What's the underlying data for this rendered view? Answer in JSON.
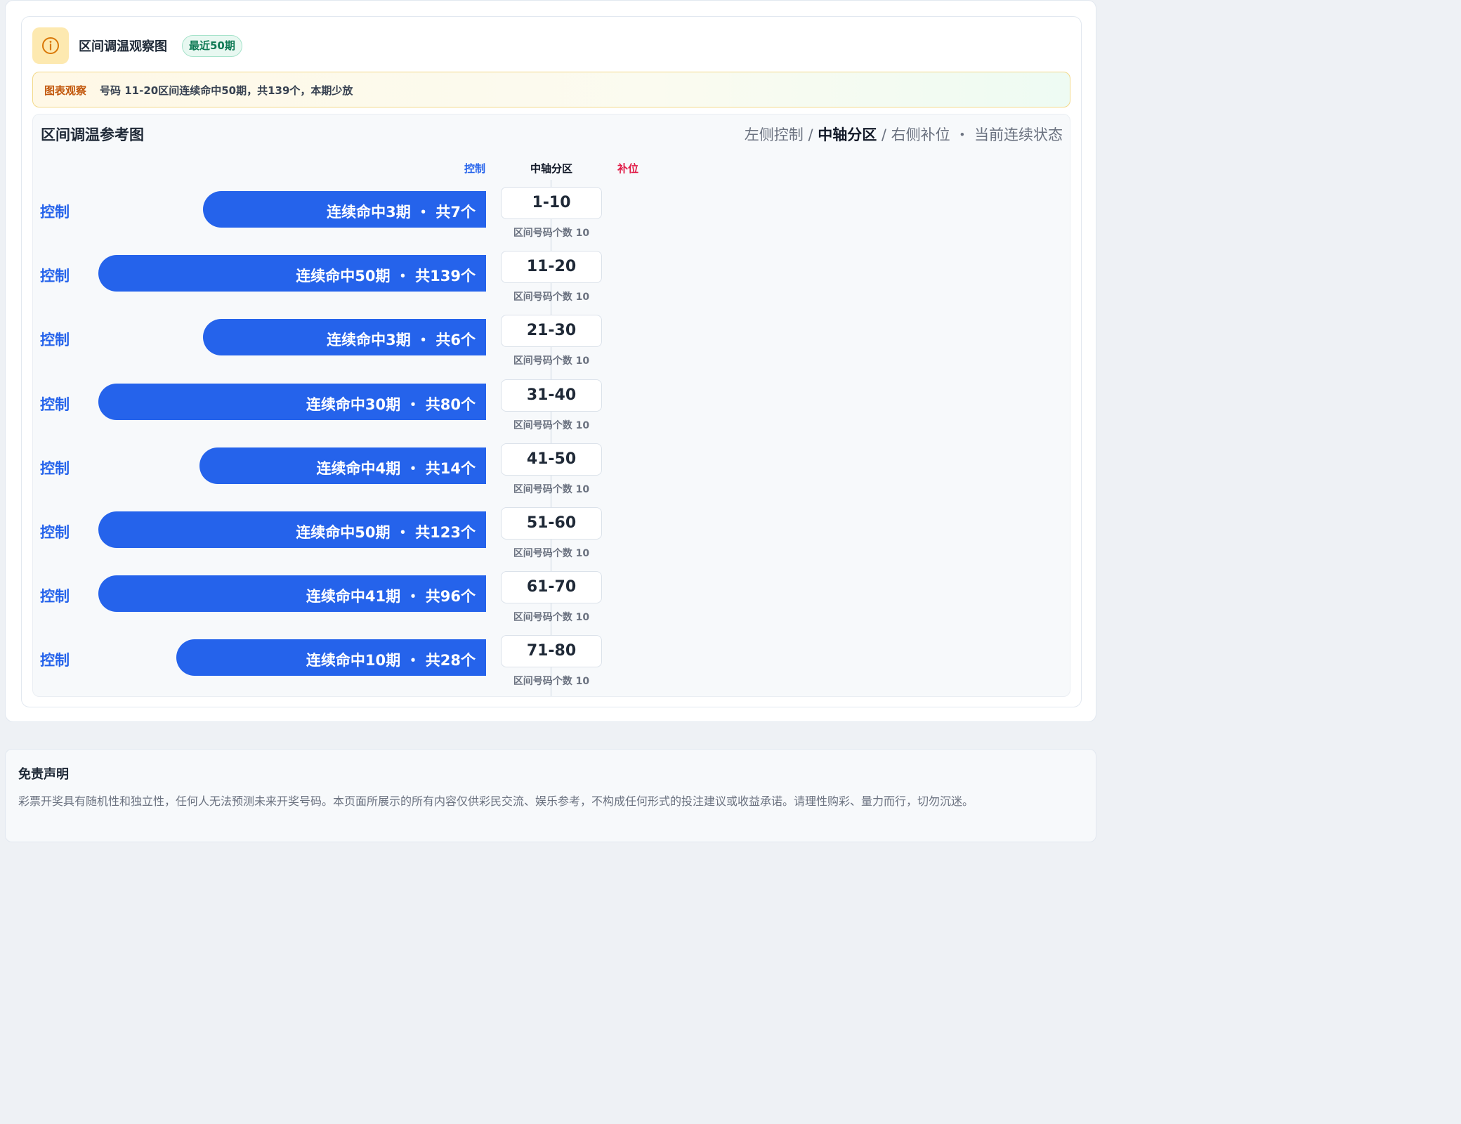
{
  "header": {
    "title": "区间调温观察图",
    "badge": "最近50期"
  },
  "observation": {
    "tag": "图表观察",
    "text": "号码 11-20区间连续命中50期，共139个，本期少放"
  },
  "panel": {
    "title": "区间调温参考图",
    "legend": {
      "part1": "左侧控制 / ",
      "part2": "中轴分区",
      "part3": " / 右侧补位 ・ 当前连续状态"
    },
    "col_left": "控制",
    "col_mid": "中轴分区",
    "col_right": "补位"
  },
  "colors": {
    "bar": "#2563eb",
    "control_label": "#2563eb",
    "fill_label": "#e11d48"
  },
  "chart_data": {
    "type": "bar",
    "orientation": "horizontal",
    "title": "区间调温参考图",
    "categories": [
      "1-10",
      "11-20",
      "21-30",
      "31-40",
      "41-50",
      "51-60",
      "61-70",
      "71-80"
    ],
    "series": [
      {
        "name": "控制",
        "values": [
          3,
          50,
          3,
          30,
          4,
          50,
          41,
          10
        ]
      }
    ],
    "totals": [
      7,
      139,
      6,
      80,
      14,
      123,
      96,
      28
    ],
    "bar_labels": [
      "连续命中3期 ・ 共7个",
      "连续命中50期 ・ 共139个",
      "连续命中3期 ・ 共6个",
      "连续命中30期 ・ 共80个",
      "连续命中4期 ・ 共14个",
      "连续命中50期 ・ 共123个",
      "连续命中41期 ・ 共96个",
      "连续命中10期 ・ 共28个"
    ],
    "side_label": "控制",
    "zone_sub": "区间号码个数 10",
    "xlim": [
      0,
      30
    ],
    "grid": false
  },
  "disclaimer": {
    "title": "免责声明",
    "text": "彩票开奖具有随机性和独立性，任何人无法预测未来开奖号码。本页面所展示的所有内容仅供彩民交流、娱乐参考，不构成任何形式的投注建议或收益承诺。请理性购彩、量力而行，切勿沉迷。"
  }
}
